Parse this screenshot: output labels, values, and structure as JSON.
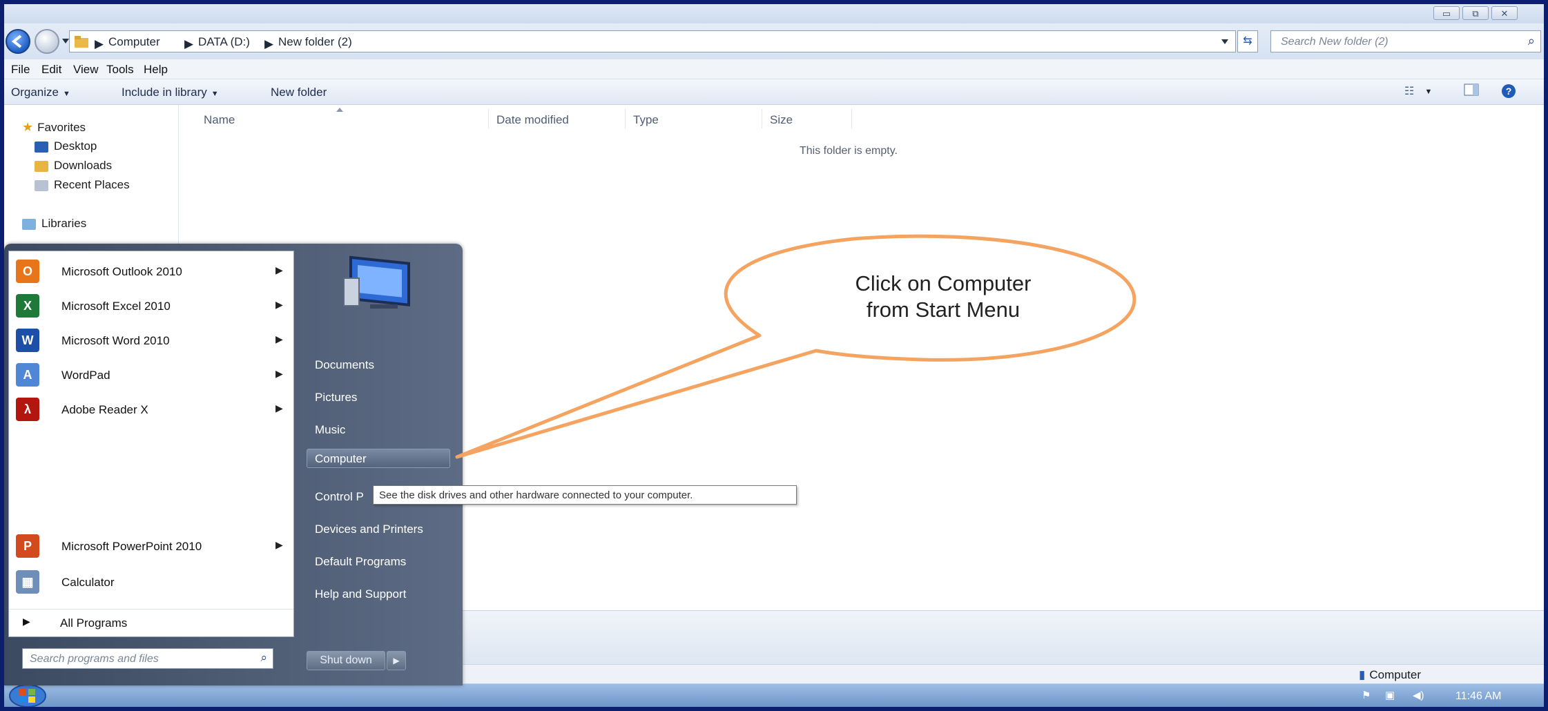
{
  "window": {
    "buttons": {
      "minimize": "▭",
      "restore": "⧉",
      "close": "✕"
    }
  },
  "address": {
    "crumbs": [
      "Computer",
      "DATA (D:)",
      "New folder (2)"
    ],
    "search_placeholder": "Search New folder (2)"
  },
  "menubar": [
    "File",
    "Edit",
    "View",
    "Tools",
    "Help"
  ],
  "commandbar": {
    "organize": "Organize",
    "include_library": "Include in library",
    "new_folder": "New folder"
  },
  "navpane": {
    "favorites": "Favorites",
    "items": [
      "Desktop",
      "Downloads",
      "Recent Places"
    ],
    "libraries": "Libraries"
  },
  "columns": [
    "Name",
    "Date modified",
    "Type",
    "Size"
  ],
  "empty_message": "This folder is empty.",
  "start_menu": {
    "programs": [
      {
        "label": "Microsoft Outlook 2010",
        "icon": "outlook-icon",
        "color": "#e8751a",
        "glyph": "O"
      },
      {
        "label": "Microsoft Excel 2010",
        "icon": "excel-icon",
        "color": "#1f7a3a",
        "glyph": "X"
      },
      {
        "label": "Microsoft Word 2010",
        "icon": "word-icon",
        "color": "#1e4fa8",
        "glyph": "W"
      },
      {
        "label": "WordPad",
        "icon": "wordpad-icon",
        "color": "#4f86d6",
        "glyph": "A"
      },
      {
        "label": "Adobe Reader X",
        "icon": "adobe-reader-icon",
        "color": "#b3150f",
        "glyph": "λ"
      }
    ],
    "lower_programs": [
      {
        "label": "Microsoft PowerPoint 2010",
        "icon": "powerpoint-icon",
        "color": "#d24a1e",
        "glyph": "P"
      },
      {
        "label": "Calculator",
        "icon": "calculator-icon",
        "color": "#6f8fb8",
        "glyph": "▦"
      }
    ],
    "all_programs": "All Programs",
    "search_placeholder": "Search programs and files",
    "right_links": [
      "Documents",
      "Pictures",
      "Music",
      "Computer",
      "Control P",
      "Devices and Printers",
      "Default Programs",
      "Help and Support"
    ],
    "shutdown": "Shut down"
  },
  "tooltip": "See the disk drives and other hardware connected to your computer.",
  "callout": {
    "line1": "Click on Computer",
    "line2": "from Start Menu",
    "color": "#f4a460"
  },
  "statusbar": {
    "computer": "Computer"
  },
  "taskbar": {
    "clock": "11:46 AM"
  }
}
